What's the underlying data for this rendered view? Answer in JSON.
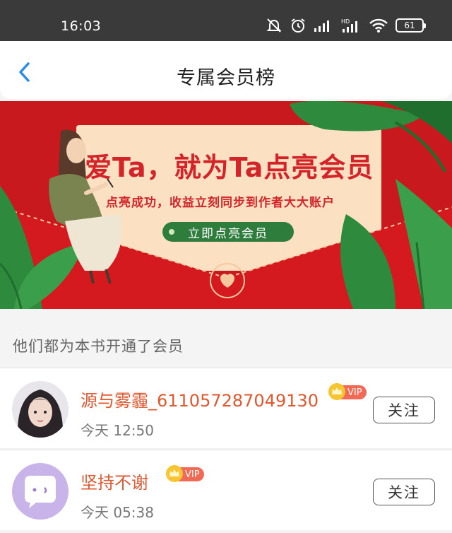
{
  "status_bar": {
    "time": "16:03",
    "battery": "61"
  },
  "header": {
    "title": "专属会员榜"
  },
  "banner": {
    "headline": "爱Ta，就为Ta点亮会员",
    "subtitle": "点亮成功，收益立刻同步到作者大大账户",
    "cta_label": "立即点亮会员"
  },
  "section": {
    "heading": "他们都为本书开通了会员"
  },
  "members": [
    {
      "name": "源与雾霾_611057287049130",
      "badge": "VIP",
      "time": "今天 12:50",
      "follow_label": "关注",
      "avatar": "photo-avatar"
    },
    {
      "name": "坚持不谢",
      "badge": "VIP",
      "time": "今天 05:38",
      "follow_label": "关注",
      "avatar": "default-chat-avatar"
    }
  ],
  "colors": {
    "accent_name": "#e0582f",
    "banner_red": "#c8191e",
    "cta_green": "#2f7d3c",
    "back_arrow": "#2b8be6",
    "vip_badge": "#f26a55"
  }
}
